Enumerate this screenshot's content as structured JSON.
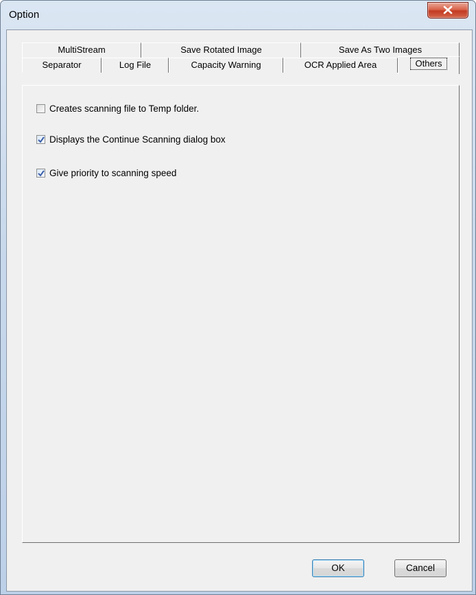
{
  "window": {
    "title": "Option"
  },
  "tabs": {
    "row1": [
      {
        "label": "MultiStream"
      },
      {
        "label": "Save Rotated Image"
      },
      {
        "label": "Save As Two Images"
      }
    ],
    "row2": [
      {
        "label": "Separator"
      },
      {
        "label": "Log File"
      },
      {
        "label": "Capacity Warning"
      },
      {
        "label": "OCR Applied Area"
      },
      {
        "label": "Others",
        "selected": true
      }
    ]
  },
  "options": [
    {
      "label": "Creates scanning file to Temp folder.",
      "checked": false
    },
    {
      "label": "Displays the Continue Scanning dialog box",
      "checked": true
    },
    {
      "label": "Give priority to scanning speed",
      "checked": true
    }
  ],
  "buttons": {
    "ok": "OK",
    "cancel": "Cancel"
  },
  "colors": {
    "close": "#c23a22",
    "check_mark": "#3a5fa8"
  }
}
